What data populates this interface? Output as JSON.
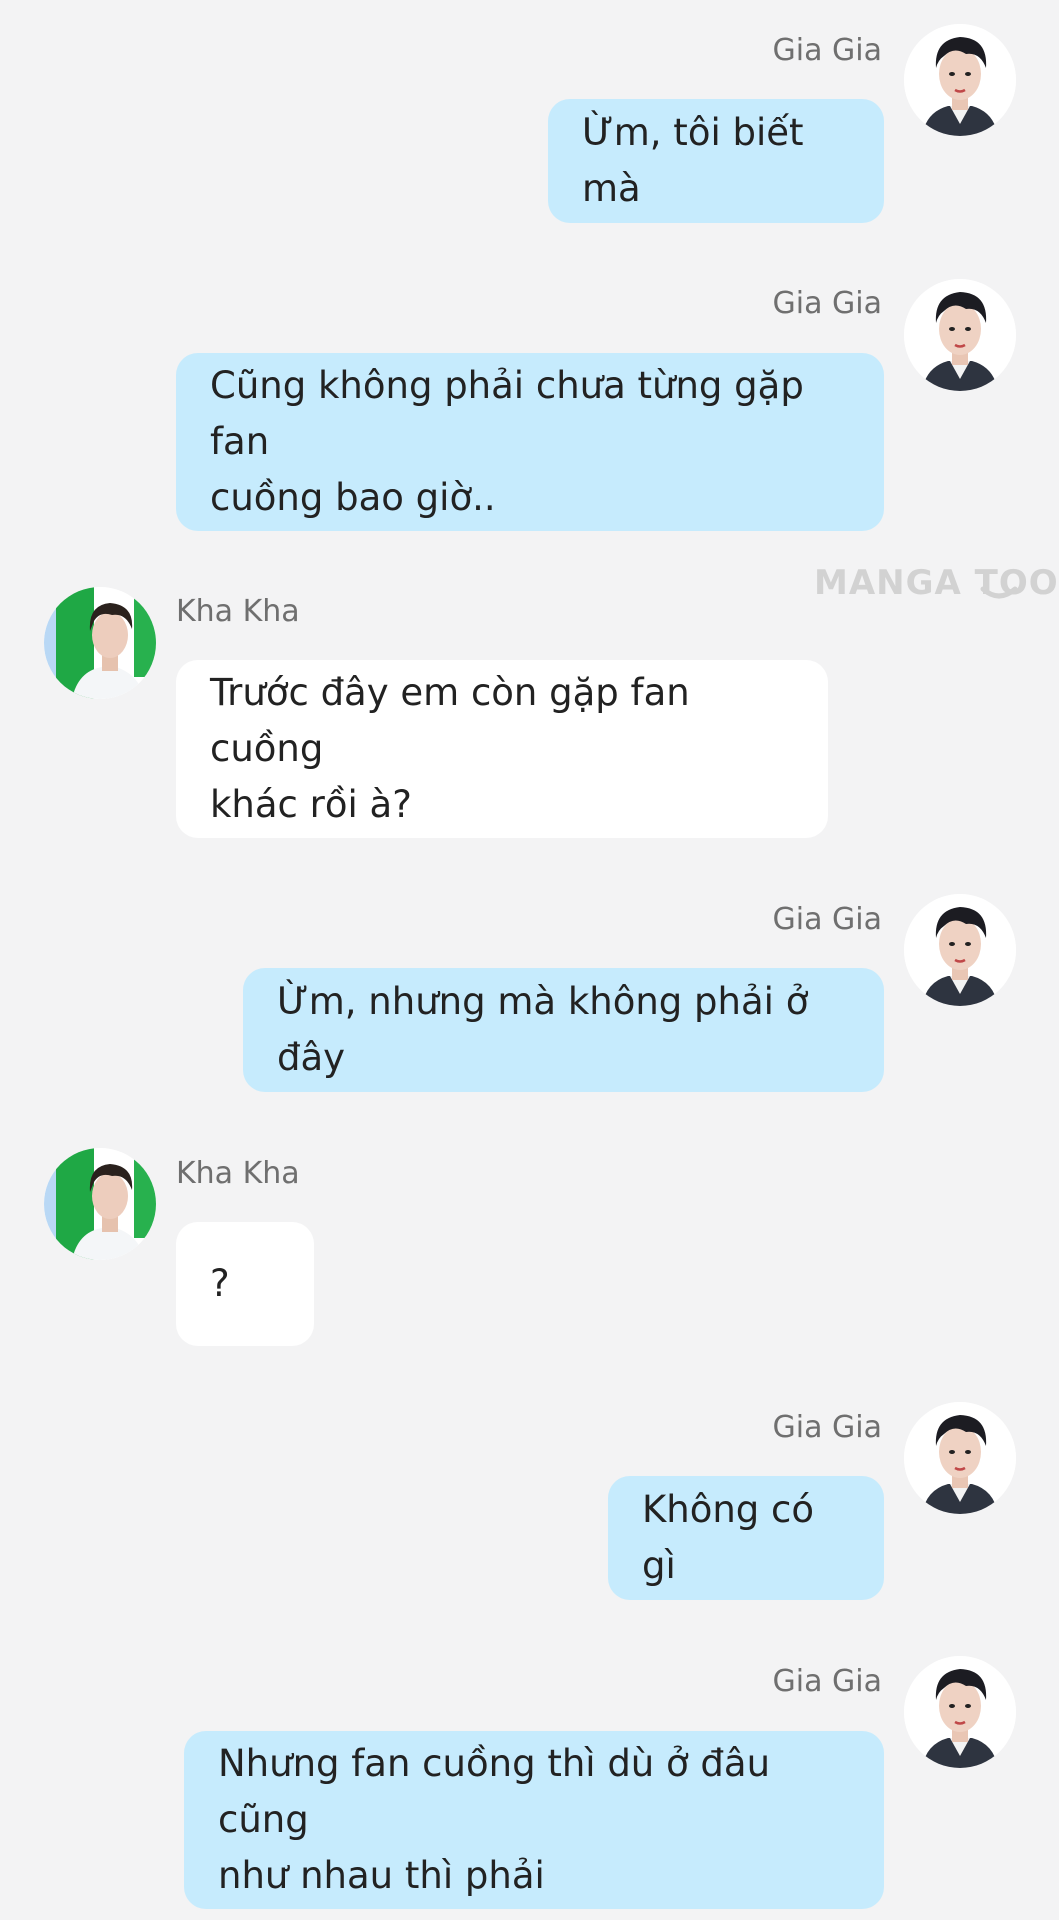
{
  "watermark": "MANGA TOON",
  "colors": {
    "background": "#f3f3f4",
    "outgoing_bubble": "#c6ebfd",
    "incoming_bubble": "#ffffff",
    "name_text": "#6f6f6f"
  },
  "messages": [
    {
      "sender": "Gia Gia",
      "side": "right",
      "text": "Ừm, tôi biết mà"
    },
    {
      "sender": "Gia Gia",
      "side": "right",
      "text": "Cũng không phải chưa từng gặp fan\ncuồng bao giờ.."
    },
    {
      "sender": "Kha Kha",
      "side": "left",
      "text": "Trước đây em còn gặp fan cuồng\nkhác rồi à?"
    },
    {
      "sender": "Gia Gia",
      "side": "right",
      "text": "Ừm, nhưng mà không phải ở đây"
    },
    {
      "sender": "Kha Kha",
      "side": "left",
      "text": "?"
    },
    {
      "sender": "Gia Gia",
      "side": "right",
      "text": "Không có gì"
    },
    {
      "sender": "Gia Gia",
      "side": "right",
      "text": "Nhưng fan cuồng thì dù ở đâu cũng\nnhư nhau thì phải"
    }
  ]
}
